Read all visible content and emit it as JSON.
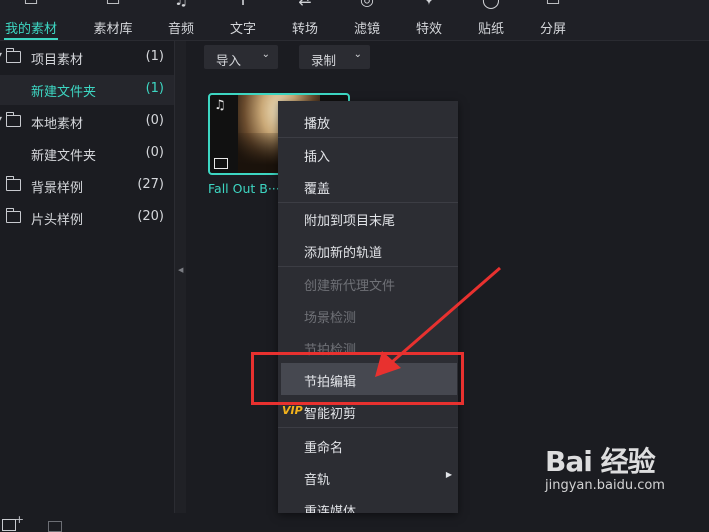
{
  "toolbar": {
    "tabs": [
      {
        "label": "我的素材",
        "icon": "media-box-icon",
        "active": true
      },
      {
        "label": "素材库",
        "icon": "library-icon",
        "active": false
      },
      {
        "label": "音频",
        "icon": "music-note-icon",
        "active": false
      },
      {
        "label": "文字",
        "icon": "text-icon",
        "active": false
      },
      {
        "label": "转场",
        "icon": "transition-icon",
        "active": false
      },
      {
        "label": "滤镜",
        "icon": "filter-icon",
        "active": false
      },
      {
        "label": "特效",
        "icon": "effects-icon",
        "active": false
      },
      {
        "label": "贴纸",
        "icon": "sticker-icon",
        "active": false
      },
      {
        "label": "分屏",
        "icon": "split-screen-icon",
        "active": false
      }
    ],
    "accent_color": "#3dd6c2"
  },
  "tree": {
    "items": [
      {
        "label": "项目素材",
        "count": "(1)",
        "has_folder": true,
        "selected": false
      },
      {
        "label": "新建文件夹",
        "count": "(1)",
        "has_folder": false,
        "selected": true
      },
      {
        "label": "本地素材",
        "count": "(0)",
        "has_folder": true,
        "selected": false
      },
      {
        "label": "新建文件夹",
        "count": "(0)",
        "has_folder": false,
        "selected": false
      },
      {
        "label": "背景样例",
        "count": "(27)",
        "has_folder": true,
        "selected": false
      },
      {
        "label": "片头样例",
        "count": "(20)",
        "has_folder": true,
        "selected": false
      }
    ]
  },
  "main": {
    "import_label": "导入",
    "record_label": "录制",
    "clip_title": "Fall Out B···"
  },
  "context_menu": {
    "items": [
      {
        "label": "播放",
        "enabled": true
      },
      {
        "label": "插入",
        "enabled": true
      },
      {
        "label": "覆盖",
        "enabled": true
      },
      {
        "label": "附加到项目末尾",
        "enabled": true
      },
      {
        "label": "添加新的轨道",
        "enabled": true
      },
      {
        "label": "创建新代理文件",
        "enabled": false
      },
      {
        "label": "场景检测",
        "enabled": false
      },
      {
        "label": "节拍检测",
        "enabled": false
      },
      {
        "label": "节拍编辑",
        "enabled": true,
        "highlighted": true
      },
      {
        "label": "智能初剪",
        "enabled": true,
        "vip": true
      },
      {
        "label": "重命名",
        "enabled": true
      },
      {
        "label": "音轨",
        "enabled": true,
        "submenu": true
      },
      {
        "label": "重连媒体",
        "enabled": true
      }
    ],
    "vip_badge": "VIP"
  },
  "annotation": {
    "color": "#e8312f"
  },
  "watermark": {
    "logo": "Bai 经验",
    "url": "jingyan.baidu.com"
  }
}
